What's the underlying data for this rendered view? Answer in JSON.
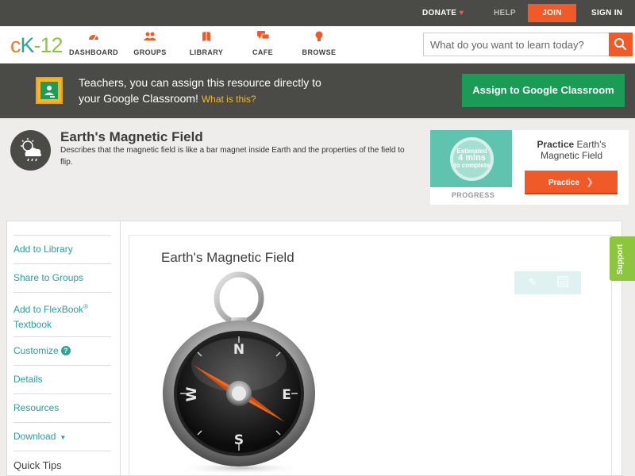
{
  "topbar": {
    "donate": "DONATE",
    "help": "HELP",
    "join": "JOIN",
    "signin": "SIGN IN"
  },
  "nav": {
    "logo_c": "c",
    "logo_k": "K",
    "logo_dash": "-",
    "logo_num": "12",
    "items": [
      {
        "label": "DASHBOARD",
        "icon": "dashboard-icon"
      },
      {
        "label": "GROUPS",
        "icon": "groups-icon"
      },
      {
        "label": "LIBRARY",
        "icon": "library-icon"
      },
      {
        "label": "CAFE",
        "icon": "cafe-icon"
      },
      {
        "label": "BROWSE",
        "icon": "browse-icon"
      }
    ],
    "search_placeholder": "What do you want to learn today?"
  },
  "banner": {
    "line1": "Teachers, you can assign this resource directly to",
    "line2": "your Google Classroom!",
    "what": "What is this?",
    "assign_label": "Assign to Google Classroom"
  },
  "concept": {
    "title": "Earth's Magnetic Field",
    "description": "Describes that the magnetic field is like a bar magnet inside Earth and the properties of the field to flip."
  },
  "practice": {
    "estimated": "Estimated",
    "mins": "4 mins",
    "to_complete": "to complete",
    "progress_label": "PROGRESS",
    "title_bold": "Practice",
    "title_rest": "Earth's Magnetic Field",
    "button": "Practice"
  },
  "sidebar": {
    "add_library": "Add to Library",
    "share_groups": "Share to Groups",
    "add_flexbook_1": "Add to FlexBook",
    "add_flexbook_reg": "®",
    "add_flexbook_2": "Textbook",
    "customize": "Customize",
    "details": "Details",
    "resources": "Resources",
    "download": "Download",
    "quick_tips": "Quick Tips"
  },
  "main": {
    "title": "Earth's Magnetic Field",
    "compass_letters": {
      "n": "N",
      "s": "S",
      "e": "E",
      "w": "W"
    }
  },
  "support": "Support",
  "colors": {
    "accent": "#f05a28",
    "dark": "#4a4a47",
    "teal": "#2aa59a",
    "green": "#1a9c56",
    "support": "#8cc63f"
  }
}
